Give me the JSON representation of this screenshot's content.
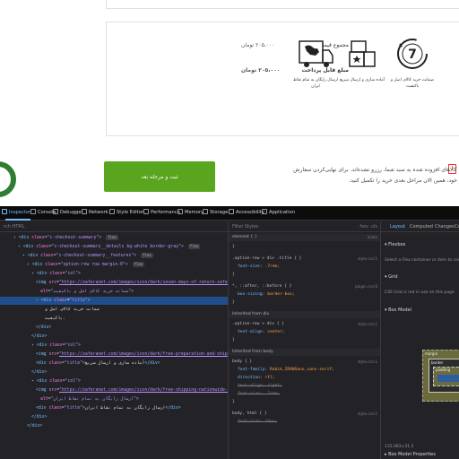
{
  "checkout": {
    "total_label": "مجموع قیمت کالاها",
    "total_value": "۲۰۵،۰۰۰ تومان",
    "payable_label": "مبلغ قابل پرداخت",
    "payable_value": "۲۰۵،۰۰۰ تومان",
    "features": [
      {
        "icon": "seven-days-return-icon",
        "title": "ضمانت خرید کالای اصل و باکیفیت"
      },
      {
        "icon": "free-preparation-shipping-icon",
        "title": "آماده سازی و ارسال سریع"
      },
      {
        "icon": "free-shipping-truck-icon",
        "title": "ارسال رایگان به تمام نقاط ایران"
      }
    ],
    "submit_label": "ثبت و مرحله بعد",
    "notice_text": "کالاهای افزوده شده به سبد شما، رزرو نشده‌اند. برای نهایی‌کردن سفارش خود، همین الان مراحل بعدی خرید را تکمیل کنید.",
    "notice_icon": "!"
  },
  "devtools": {
    "tabs": [
      "Inspector",
      "Console",
      "Debugger",
      "Network",
      "Style Editor",
      "Performance",
      "Memory",
      "Storage",
      "Accessibility",
      "Application"
    ],
    "search_placeholder": "rch HTML",
    "markup_lines": [
      {
        "indent": 3,
        "html": "<span class='arrow'>▾</span> <span class='tag'>&lt;div</span> <span class='attr'>class</span>=<span class='val'>\"c-checkout-summary\"</span><span class='tag'>&gt;</span> <span class='badge'>flex</span>"
      },
      {
        "indent": 4,
        "html": "<span class='arrow'>▾</span> <span class='tag'>&lt;div</span> <span class='attr'>class</span>=<span class='val'>\"c-checkout-summary__details bg-white border-gray\"</span><span class='tag'>&gt;</span> <span class='badge'>flex</span>"
      },
      {
        "indent": 5,
        "html": "<span class='arrow'>▾</span> <span class='tag'>&lt;div</span> <span class='attr'>class</span>=<span class='val'>\"c-checkout-summary__features\"</span><span class='tag'>&gt;</span> <span class='badge'>flex</span>"
      },
      {
        "indent": 6,
        "html": "<span class='arrow'>▾</span> <span class='tag'>&lt;div</span> <span class='attr'>class</span>=<span class='val'>\"option-row row margin-0\"</span><span class='tag'>&gt;</span> <span class='badge'>flex</span>"
      },
      {
        "indent": 7,
        "html": "<span class='arrow'>▾</span> <span class='tag'>&lt;div</span> <span class='attr'>class</span>=<span class='val'>\"col\"</span><span class='tag'>&gt;</span>"
      },
      {
        "indent": 8,
        "html": "<span class='tag'>&lt;img</span> <span class='attr'>src</span>=<span class='url'>\"https://zaferanet.com/images/icon/dark/seven-days-of-return-zaferanet.webp\"</span>"
      },
      {
        "indent": 9,
        "html": "<span class='attr'>alt</span>=<span class='val'>\"ضمانت خرید کالای اصل و باکیفیت\"</span><span class='tag'>&gt;</span>"
      },
      {
        "indent": 8,
        "html": "<span class='arrow'>▾</span> <span class='tag'>&lt;div</span> <span class='attr'>class</span>=<span class='val'>\"title\"</span><span class='tag'>&gt;</span>",
        "selected": true
      },
      {
        "indent": 10,
        "html": "<span class='txt'>ضمانت خرید کالای اصل و</span>"
      },
      {
        "indent": 10,
        "html": "<span class='txt'>باکیفیت.</span>"
      },
      {
        "indent": 8,
        "html": "<span class='tag'>&lt;/div&gt;</span>"
      },
      {
        "indent": 7,
        "html": "<span class='tag'>&lt;/div&gt;</span>"
      },
      {
        "indent": 7,
        "html": "<span class='arrow'>▾</span> <span class='tag'>&lt;div</span> <span class='attr'>class</span>=<span class='val'>\"col\"</span><span class='tag'>&gt;</span>"
      },
      {
        "indent": 8,
        "html": "<span class='tag'>&lt;img</span> <span class='attr'>src</span>=<span class='url'>\"https://zaferanet.com/images/icon/dark/free-preparation-and-shipping-zaferanet.webp\"</span> <span class='attr'>alt</span>=<span class='val'>\"آماده سازی و ارسال سریع\"</span><span class='tag'>&gt;</span>"
      },
      {
        "indent": 8,
        "html": "<span class='tag'>&lt;div</span> <span class='attr'>class</span>=<span class='val'>\"title\"</span><span class='tag'>&gt;</span><span class='txt'>آماده سازی و ارسال سریع</span><span class='tag'>&lt;/div&gt;</span>"
      },
      {
        "indent": 7,
        "html": "<span class='tag'>&lt;/div&gt;</span>"
      },
      {
        "indent": 7,
        "html": "<span class='arrow'>▾</span> <span class='tag'>&lt;div</span> <span class='attr'>class</span>=<span class='val'>\"col\"</span><span class='tag'>&gt;</span>"
      },
      {
        "indent": 8,
        "html": "<span class='tag'>&lt;img</span> <span class='attr'>src</span>=<span class='url'>\"https://zaferanet.com/images/icon/dark/free-shipping-nationwide-zaferanet.webp\"</span>"
      },
      {
        "indent": 9,
        "html": "<span class='attr'>alt</span>=<span class='val'>\"ارسال رایگان به تمام نقاط ایران\"</span><span class='tag'>&gt;</span>"
      },
      {
        "indent": 8,
        "html": "<span class='tag'>&lt;div</span> <span class='attr'>class</span>=<span class='val'>\"title\"</span><span class='tag'>&gt;</span><span class='txt'>ارسال رایگان به تمام نقاط ایران</span><span class='tag'>&lt;/div&gt;</span>"
      },
      {
        "indent": 7,
        "html": "<span class='tag'>&lt;/div&gt;</span>"
      },
      {
        "indent": 6,
        "html": "<span class='tag'>&lt;/div&gt;</span>"
      }
    ],
    "rules_filter": "Filter Styles",
    "rules_tools": ":hov .cls",
    "rules": [
      {
        "kind": "head",
        "text": "element { }",
        "src": "inline"
      },
      {
        "kind": "rule",
        "text": "}",
        "src": ""
      },
      {
        "kind": "rule",
        "text": ".option-row > div .title { }",
        "src": "style.css:1"
      },
      {
        "kind": "decl",
        "prop": "font-size",
        "val": ".7rem;",
        "strike": false
      },
      {
        "kind": "rule",
        "text": "}",
        "src": ""
      },
      {
        "kind": "rule",
        "text": "*, ::after, ::before { }",
        "src": "plugin.css:6"
      },
      {
        "kind": "decl",
        "prop": "box-sizing",
        "val": "border-box;",
        "strike": false
      },
      {
        "kind": "rule",
        "text": "}",
        "src": ""
      },
      {
        "kind": "head",
        "text": "Inherited from div",
        "src": ""
      },
      {
        "kind": "rule",
        "text": ".option-row > div { }",
        "src": "style.css:1"
      },
      {
        "kind": "decl",
        "prop": "text-align",
        "val": "center;",
        "strike": false
      },
      {
        "kind": "rule",
        "text": "}",
        "src": ""
      },
      {
        "kind": "head",
        "text": "Inherited from body",
        "src": ""
      },
      {
        "kind": "rule",
        "text": "body { }",
        "src": "style.css:1"
      },
      {
        "kind": "decl",
        "prop": "font-family",
        "val": "Rubik,IRANSans,sans-serif;",
        "strike": false
      },
      {
        "kind": "decl",
        "prop": "direction",
        "val": "rtl;",
        "strike": false
      },
      {
        "kind": "decl",
        "prop": "text-align",
        "val": "right;",
        "strike": true
      },
      {
        "kind": "decl",
        "prop": "font-size",
        "val": ".7rem;",
        "strike": true
      },
      {
        "kind": "rule",
        "text": "}",
        "src": ""
      },
      {
        "kind": "rule",
        "text": "body, html { }",
        "src": "style.css:1"
      },
      {
        "kind": "decl",
        "prop": "font-size",
        "val": "14px;",
        "strike": true
      }
    ],
    "layout_tabs": [
      "Layout",
      "Computed",
      "Changes",
      "Co"
    ],
    "flexbox_label": "Flexbox",
    "flexbox_note": "Select a Flex container or item to continue.",
    "grid_label": "Grid",
    "grid_note": "CSS Grid is not in use on this page",
    "boxmodel_label": "Box Model",
    "boxmodel_margin": "margin",
    "boxmodel_border": "border",
    "boxmodel_padding": "padding",
    "boxmodel_size": "135.083×31.5",
    "boxmodel_props": "Box Model Properties"
  }
}
